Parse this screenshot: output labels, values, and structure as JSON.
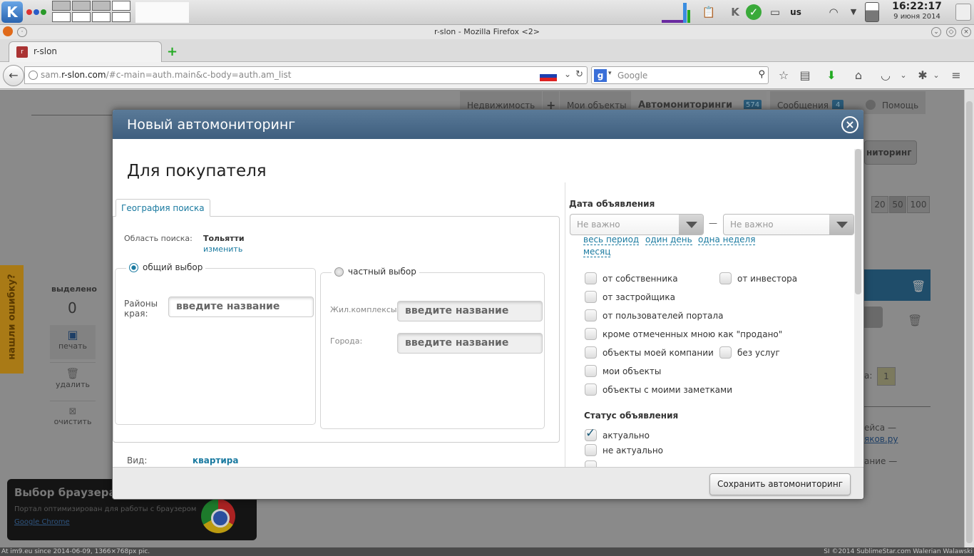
{
  "panel": {
    "clock_time": "16:22:17",
    "clock_date": "9 июня 2014",
    "keyboard_layout": "us"
  },
  "firefox": {
    "window_title": "r-slon - Mozilla Firefox <2>",
    "tab_title": "r-slon",
    "url_prefix": "sam.",
    "url_domain": "r-slon.com",
    "url_path": "/#c-main=auth.main&c-body=auth.am_list",
    "search_placeholder": "Google"
  },
  "background_page": {
    "nav_tabs": [
      "Недвижимость",
      "Мои объекты",
      "Автомониторинги",
      "Сообщения",
      "Помощь"
    ],
    "automonitor_count": "574",
    "messages_count": "4",
    "side_selected_label": "выделено",
    "side_selected_count": "0",
    "side_print": "печать",
    "side_delete": "удалить",
    "side_clear": "очистить",
    "found_error_tab": "нашли ошибку?",
    "add_monitor_button": "ниторинг",
    "page_sizes": [
      "20",
      "50",
      "100"
    ],
    "page_label": "а:",
    "page_number": "1",
    "right_text_1": "ейса —",
    "right_link": "яков.ру",
    "right_text_2": "ание —",
    "browser_box_title": "Выбор браузера",
    "browser_box_text": "Портал оптимизирован для работы с браузером",
    "browser_box_link": "Google Chrome"
  },
  "dialog": {
    "title": "Новый автомониторинг",
    "subtitle": "Для покупателя",
    "geo_tab": "География поиска",
    "area_label": "Область поиска:",
    "area_value": "Тольятти",
    "area_change": "изменить",
    "general_choice": "общий выбор",
    "private_choice": "частный выбор",
    "districts_label_1": "Районы",
    "districts_label_2": "края:",
    "districts_placeholder": "введите название",
    "complexes_label": "Жил.комплексы:",
    "complexes_placeholder": "введите название",
    "cities_label": "Города:",
    "cities_placeholder": "введите название",
    "type_label": "Вид:",
    "type_value": "квартира",
    "date_section": "Дата объявления",
    "date_from": "Не важно",
    "date_to": "Не важно",
    "date_sep": "—",
    "period_links": [
      "весь период",
      "один день",
      "одна неделя",
      "месяц"
    ],
    "source_options": [
      {
        "label": "от собственника",
        "checked": false
      },
      {
        "label": "от инвестора",
        "checked": false
      },
      {
        "label": "от застройщика",
        "checked": false
      },
      {
        "label": "от пользователей портала",
        "checked": false
      },
      {
        "label": "кроме отмеченных мною как \"продано\"",
        "checked": false
      },
      {
        "label": "объекты моей компании",
        "checked": false
      },
      {
        "label": "без услуг",
        "checked": false
      },
      {
        "label": "мои объекты",
        "checked": false
      },
      {
        "label": "объекты с моими заметками",
        "checked": false
      }
    ],
    "status_section": "Статус объявления",
    "status_options": [
      {
        "label": "актуально",
        "checked": true
      },
      {
        "label": "не актуально",
        "checked": false
      }
    ],
    "save_button": "Сохранить автомониторинг"
  },
  "status_bar": {
    "left": "At im9.eu since 2014-06-09, 1366×768px pic.",
    "right": "SI ©2014 SublimeStar.com Walerian Walawski"
  },
  "colors": {
    "dialog_header": "#4b6b8b",
    "link": "#1a7aa0",
    "overlay": "#8a8a8a"
  }
}
